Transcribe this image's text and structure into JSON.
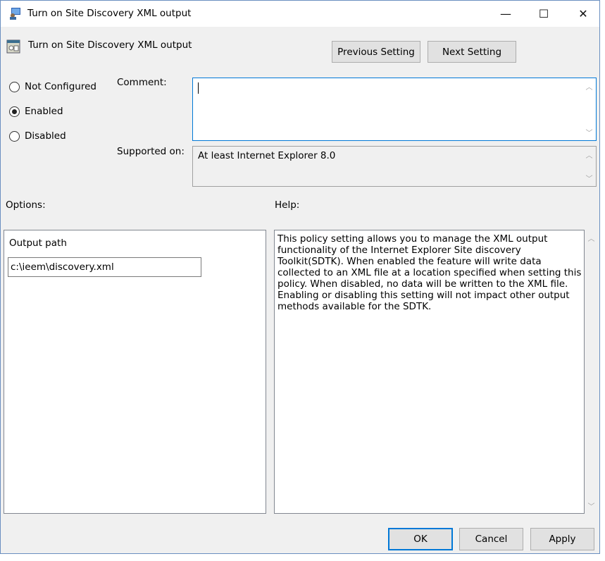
{
  "window": {
    "title": "Turn on Site Discovery XML output",
    "minimize": "—",
    "maximize": "☐",
    "close": "✕"
  },
  "header": {
    "title": "Turn on Site Discovery XML output",
    "previous_label": "Previous Setting",
    "next_label": "Next Setting"
  },
  "state": {
    "options": [
      {
        "label": "Not Configured",
        "selected": false
      },
      {
        "label": "Enabled",
        "selected": true
      },
      {
        "label": "Disabled",
        "selected": false
      }
    ]
  },
  "comment": {
    "label": "Comment:",
    "value": ""
  },
  "supported": {
    "label": "Supported on:",
    "value": "At least Internet Explorer 8.0"
  },
  "options": {
    "label": "Options:",
    "output_path_label": "Output path",
    "output_path_value": "c:\\ieem\\discovery.xml"
  },
  "help": {
    "label": "Help:",
    "text": "This policy setting allows you to manage the XML output functionality of the Internet Explorer Site discovery Toolkit(SDTK). When enabled the feature will write data collected to an XML file at a location specified when setting this policy. When disabled, no data will be written to the XML file. Enabling or disabling this setting will not impact other output methods available for the SDTK."
  },
  "footer": {
    "ok": "OK",
    "cancel": "Cancel",
    "apply": "Apply"
  },
  "colors": {
    "accent": "#0078d7",
    "background": "#f0f0f0"
  }
}
